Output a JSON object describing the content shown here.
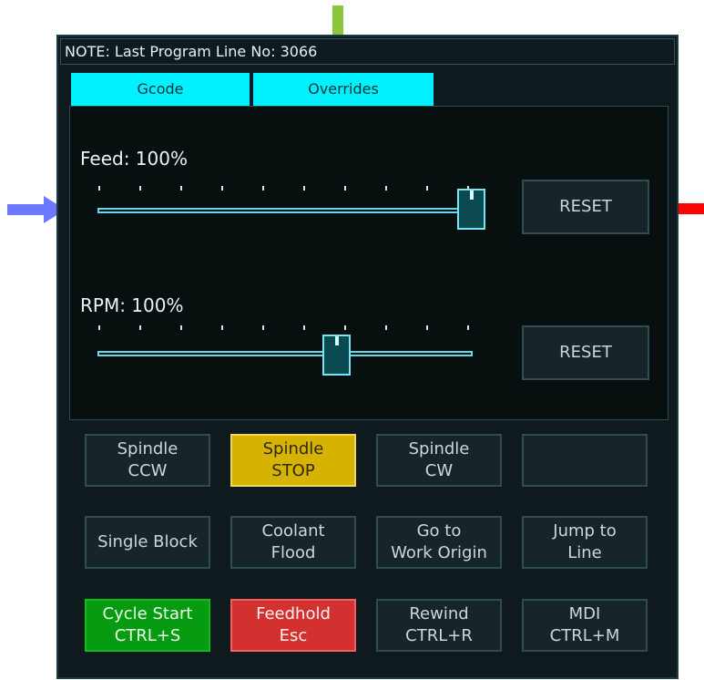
{
  "note": "NOTE: Last Program Line No: 3066",
  "tabs": {
    "gcode": "Gcode",
    "overrides": "Overrides"
  },
  "overrides": {
    "feed_label": "Feed: 100%",
    "rpm_label": "RPM: 100%",
    "feed_slider_level": 1.0,
    "rpm_slider_level": 0.6,
    "reset_label": "RESET"
  },
  "buttons": {
    "spindle_ccw": [
      "Spindle",
      "CCW"
    ],
    "spindle_stop": [
      "Spindle",
      "STOP"
    ],
    "spindle_cw": [
      "Spindle",
      "CW"
    ],
    "single_block": "Single Block",
    "coolant_flood": [
      "Coolant",
      "Flood"
    ],
    "go_to_work_origin": [
      "Go to",
      "Work Origin"
    ],
    "jump_to_line": [
      "Jump to",
      "Line"
    ],
    "cycle_start": [
      "Cycle Start",
      "CTRL+S"
    ],
    "feedhold": [
      "Feedhold",
      "Esc"
    ],
    "rewind": [
      "Rewind",
      "CTRL+R"
    ],
    "mdi": [
      "MDI",
      "CTRL+M"
    ]
  },
  "colors": {
    "tab": "#00f0ff",
    "yellow": "#d6b300",
    "green": "#079b12",
    "red": "#d2312f",
    "arrow_green": "#8cc63f",
    "arrow_blue": "#6b78ff",
    "arrow_red": "#ff0000"
  },
  "icons": [
    "down-arrow-marker-icon",
    "right-arrow-marker-icon",
    "left-arrow-marker-icon"
  ]
}
